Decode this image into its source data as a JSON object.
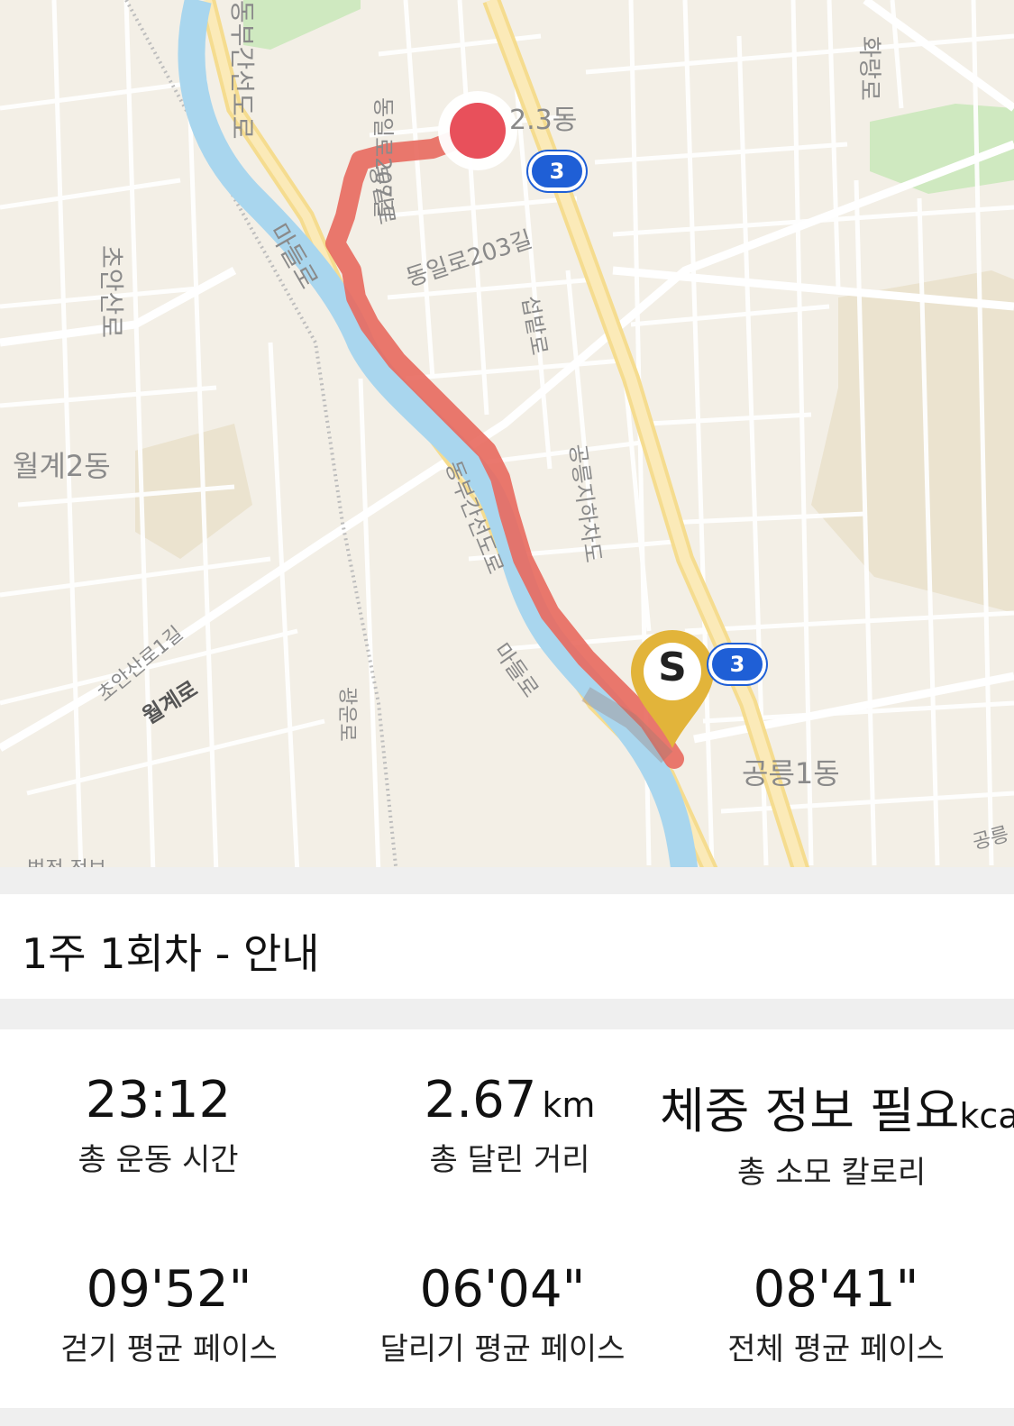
{
  "map": {
    "labels": {
      "east_expressway_top": "동부간선도로",
      "madeul_ro_top": "마들로",
      "choan_san_ro": "초안산로",
      "wolgye2": "월계2동",
      "dong_il_207": "동일로207길",
      "dong_il_ro": "동일로",
      "dong_il_203": "동일로203길",
      "seokbat_ro": "섭밭로",
      "gongneung_underpass": "공릉지하차도",
      "east_expressway_mid": "동부간선도로",
      "madeul_ro_bottom": "마들로",
      "choan_san_ro_1": "초안산로1길",
      "wolgye_ro": "월계로",
      "gwanggun_ro": "광운로",
      "gongneung1": "공릉1동",
      "gongneung_right": "공릉",
      "dong_23": "2.3동",
      "hwarang_ro": "화랑로",
      "bottom_cut": "법정 정보"
    },
    "route_badges": [
      "3",
      "3"
    ],
    "start_marker_letter": "S",
    "colors": {
      "route": "#e8695e",
      "river": "#a9d6ee",
      "park": "#cfe9c0",
      "start_pin": "#e2b43a",
      "end_dot": "#e8505b",
      "badge": "#1f5fd6"
    }
  },
  "session": {
    "title": "1주 1회차 - 안내"
  },
  "stats": {
    "total_time": {
      "value": "23:12",
      "label": "총 운동 시간"
    },
    "distance": {
      "value": "2.67",
      "unit": "km",
      "label": "총 달린 거리"
    },
    "calories": {
      "value": "체중 정보 필요",
      "unit": "kcal",
      "label": "총 소모 칼로리"
    },
    "walk_pace": {
      "value": "09'52\"",
      "label": "걷기 평균 페이스"
    },
    "run_pace": {
      "value": "06'04\"",
      "label": "달리기 평균 페이스"
    },
    "overall_pace": {
      "value": "08'41\"",
      "label": "전체 평균 페이스"
    }
  }
}
